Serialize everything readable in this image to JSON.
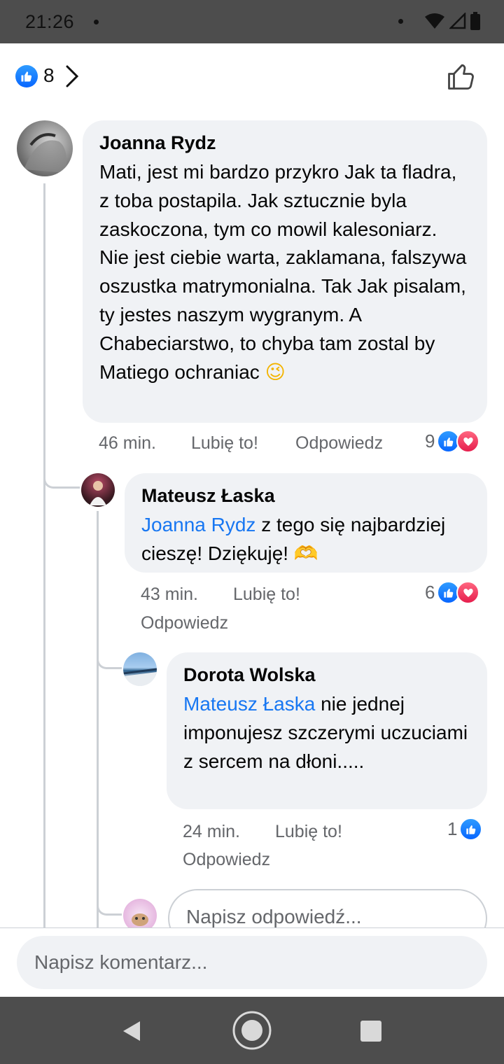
{
  "status": {
    "time": "21:26"
  },
  "reactions_header": {
    "count": "8"
  },
  "comments": [
    {
      "author": "Joanna Rydz",
      "text": "Mati, jest mi bardzo przykro  Jak ta fladra, z toba postapila. Jak sztucznie byla zaskoczona, tym co mowil kalesoniarz. Nie jest ciebie warta, zaklamana, falszywa oszustka matrymonialna. Tak Jak pisalam,  ty jestes naszym wygranym. A Chabeciarstwo, to chyba tam zostal by Matiego ochraniac",
      "emoji": "😉",
      "time": "46 min.",
      "like_label": "Lubię to!",
      "reply_label": "Odpowiedz",
      "reactions": "9"
    },
    {
      "author": "Mateusz Łaska",
      "mention": "Joanna Rydz",
      "text": " z tego się najbardziej cieszę! Dziękuję!",
      "emoji": "🫶",
      "time": "43 min.",
      "like_label": "Lubię to!",
      "reply_label": "Odpowiedz",
      "reactions": "6"
    },
    {
      "author": "Dorota Wolska",
      "mention": "Mateusz Łaska",
      "text": " nie jednej imponujesz szczerymi uczuciami z sercem na dłoni.....",
      "time": "24 min.",
      "like_label": "Lubię to!",
      "reply_label": "Odpowiedz",
      "reactions": "1"
    }
  ],
  "reply_placeholder": "Napisz odpowiedź...",
  "comment_placeholder": "Napisz komentarz..."
}
